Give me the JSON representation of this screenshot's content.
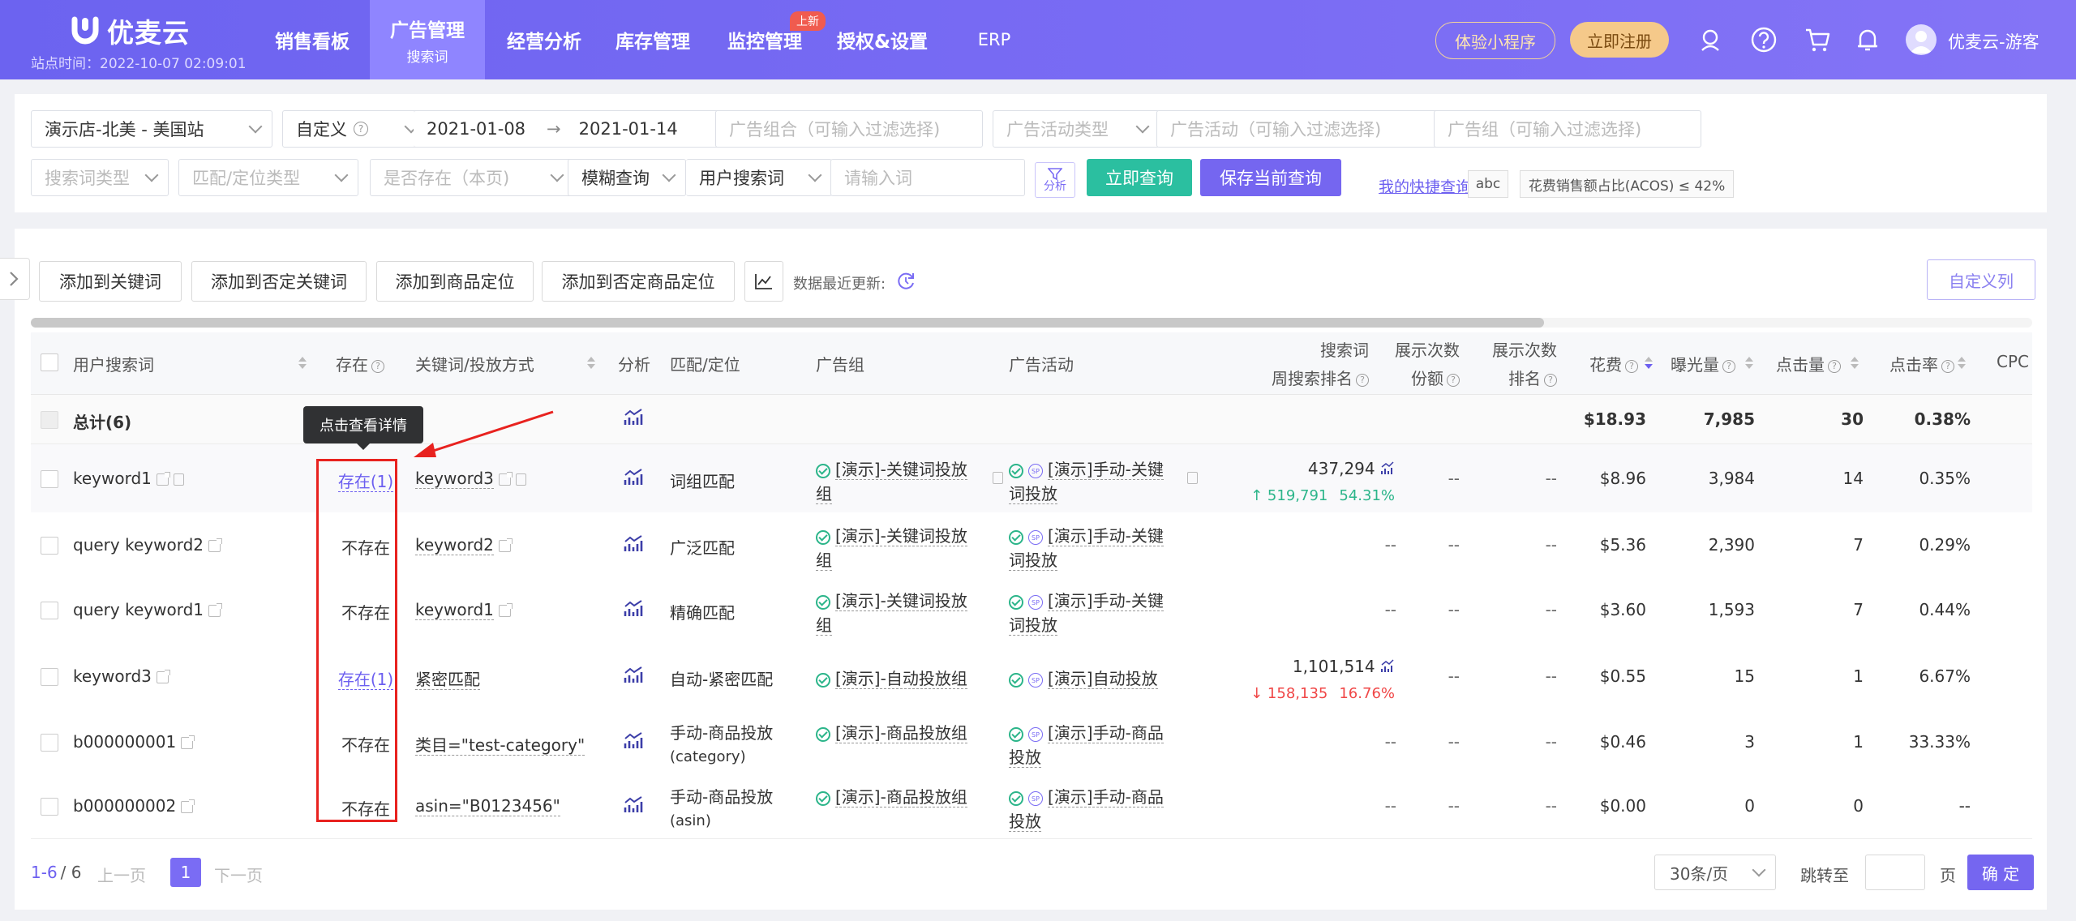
{
  "brand": {
    "name": "优麦云",
    "site_time": "站点时间：2022-10-07 02:09:01"
  },
  "nav": [
    {
      "label": "销售看板"
    },
    {
      "label": "广告管理",
      "sub": "搜索词"
    },
    {
      "label": "经营分析"
    },
    {
      "label": "库存管理"
    },
    {
      "label": "监控管理",
      "badge": "上新"
    },
    {
      "label": "授权&设置"
    },
    {
      "label": "ERP"
    }
  ],
  "header_right": {
    "mini_program": "体验小程序",
    "register": "立即注册",
    "username": "优麦云-游客"
  },
  "filters": {
    "store": "演示店-北美 - 美国站",
    "date_mode": "自定义",
    "date_start": "2021-01-08",
    "date_arrow": "→",
    "date_end": "2021-01-14",
    "ad_portfolio": "广告组合（可输入过滤选择)",
    "campaign_type": "广告活动类型",
    "campaign": "广告活动（可输入过滤选择)",
    "ad_group": "广告组（可输入过滤选择)",
    "search_term_type": "搜索词类型",
    "match_type": "匹配/定位类型",
    "exists": "是否存在（本页)",
    "fuzzy": "模糊查询",
    "field": "用户搜索词",
    "input_placeholder": "请输入词",
    "analysis": "分析",
    "query_btn": "立即查询",
    "save_btn": "保存当前查询",
    "quick_link": "我的快捷查询",
    "tag1": "abc",
    "tag2": "花费销售额占比(ACOS) ≤ 42%"
  },
  "toolbar": {
    "add_kw": "添加到关键词",
    "add_neg_kw": "添加到否定关键词",
    "add_product": "添加到商品定位",
    "add_neg_product": "添加到否定商品定位",
    "update": "数据最近更新:",
    "custom_cols": "自定义列"
  },
  "columns": {
    "search_term": "用户搜索词",
    "exists": "存在",
    "keyword": "关键词/投放方式",
    "analysis": "分析",
    "match": "匹配/定位",
    "ad_group": "广告组",
    "campaign": "广告活动",
    "rank_l1": "搜索词",
    "rank_l2": "周搜索排名",
    "share_l1": "展示次数",
    "share_l2": "份额",
    "srank_l1": "展示次数",
    "srank_l2": "排名",
    "spend": "花费",
    "impr": "曝光量",
    "clicks": "点击量",
    "ctr": "点击率",
    "cpc": "CPC"
  },
  "total": {
    "label": "总计(6)",
    "spend": "$18.93",
    "impr": "7,985",
    "clicks": "30",
    "ctr": "0.38%"
  },
  "rows": [
    {
      "term": "keyword1",
      "exists": "存在(1)",
      "keyword": "keyword3",
      "match": "词组匹配",
      "group1": "[演示]-关键词投放",
      "group2": "组",
      "camp1": "[演示]手动-关键",
      "camp2": "词投放",
      "rank": "437,294",
      "rank_delta": "↑ 519,791",
      "rank_pct": "54.31%",
      "share": "--",
      "srank": "--",
      "spend": "$8.96",
      "impr": "3,984",
      "clicks": "14",
      "ctr": "0.35%"
    },
    {
      "term": "query keyword2",
      "exists": "不存在",
      "keyword": "keyword2",
      "match": "广泛匹配",
      "group1": "[演示]-关键词投放",
      "group2": "组",
      "camp1": "[演示]手动-关键",
      "camp2": "词投放",
      "rank": "--",
      "share": "--",
      "srank": "--",
      "spend": "$5.36",
      "impr": "2,390",
      "clicks": "7",
      "ctr": "0.29%"
    },
    {
      "term": "query keyword1",
      "exists": "不存在",
      "keyword": "keyword1",
      "match": "精确匹配",
      "group1": "[演示]-关键词投放",
      "group2": "组",
      "camp1": "[演示]手动-关键",
      "camp2": "词投放",
      "rank": "--",
      "share": "--",
      "srank": "--",
      "spend": "$3.60",
      "impr": "1,593",
      "clicks": "7",
      "ctr": "0.44%"
    },
    {
      "term": "keyword3",
      "exists": "存在(1)",
      "keyword": "紧密匹配",
      "match": "自动-紧密匹配",
      "group1": "[演示]-自动投放组",
      "group2": "",
      "camp1": "[演示]自动投放",
      "camp2": "",
      "rank": "1,101,514",
      "rank_delta": "↓ 158,135",
      "rank_pct": "16.76%",
      "share": "--",
      "srank": "--",
      "spend": "$0.55",
      "impr": "15",
      "clicks": "1",
      "ctr": "6.67%"
    },
    {
      "term": "b000000001",
      "exists": "不存在",
      "keyword": "类目=\"test-category\"",
      "match": "手动-商品投放",
      "match2": "(category)",
      "group1": "[演示]-商品投放组",
      "group2": "",
      "camp1": "[演示]手动-商品",
      "camp2": "投放",
      "rank": "--",
      "share": "--",
      "srank": "--",
      "spend": "$0.46",
      "impr": "3",
      "clicks": "1",
      "ctr": "33.33%"
    },
    {
      "term": "b000000002",
      "exists": "不存在",
      "keyword": "asin=\"B0123456\"",
      "match": "手动-商品投放",
      "match2": "(asin)",
      "group1": "[演示]-商品投放组",
      "group2": "",
      "camp1": "[演示]手动-商品",
      "camp2": "投放",
      "rank": "--",
      "share": "--",
      "srank": "--",
      "spend": "$0.00",
      "impr": "0",
      "clicks": "0",
      "ctr": "--"
    }
  ],
  "tooltip": "点击查看详情",
  "pager": {
    "range": "1-6",
    "total": "/ 6",
    "prev": "上一页",
    "current": "1",
    "next": "下一页",
    "per_page": "30条/页",
    "jump": "跳转至",
    "page": "页",
    "confirm": "确 定"
  },
  "colors": {
    "accent": "#6c5ff0",
    "nav_bg": "#7a6cf4",
    "green": "#2cb58a",
    "red": "#f04747",
    "highlight": "#e8221f"
  }
}
